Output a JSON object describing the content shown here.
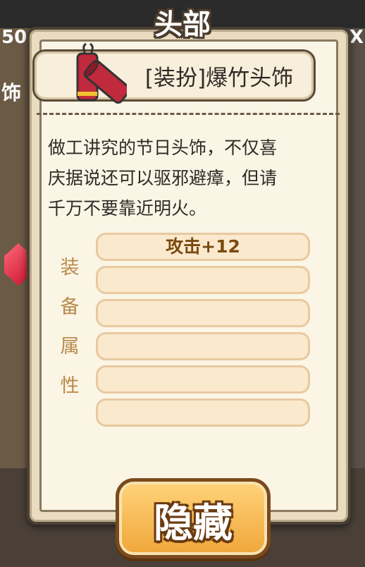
{
  "panel": {
    "title": "头部",
    "item_name": "[装扮]爆竹头饰",
    "item_icon": "firecracker-icon",
    "description_lines": [
      "做工讲究的节日头饰，不仅喜",
      "庆据说还可以驱邪避瘴，但请",
      "千万不要靠近明火。"
    ],
    "attributes_label": [
      "装",
      "备",
      "属",
      "性"
    ],
    "attribute_slots": [
      "攻击+12",
      "",
      "",
      "",
      "",
      ""
    ],
    "hide_button_label": "隐藏"
  },
  "background": {
    "left_text": "50",
    "right_text": "X",
    "left_side_text": "饰"
  },
  "colors": {
    "panel_bg": "#fbf5e6",
    "slot_bg": "#fbe9ce",
    "accent_text": "#7a4a10",
    "button": "#f0a63a"
  }
}
